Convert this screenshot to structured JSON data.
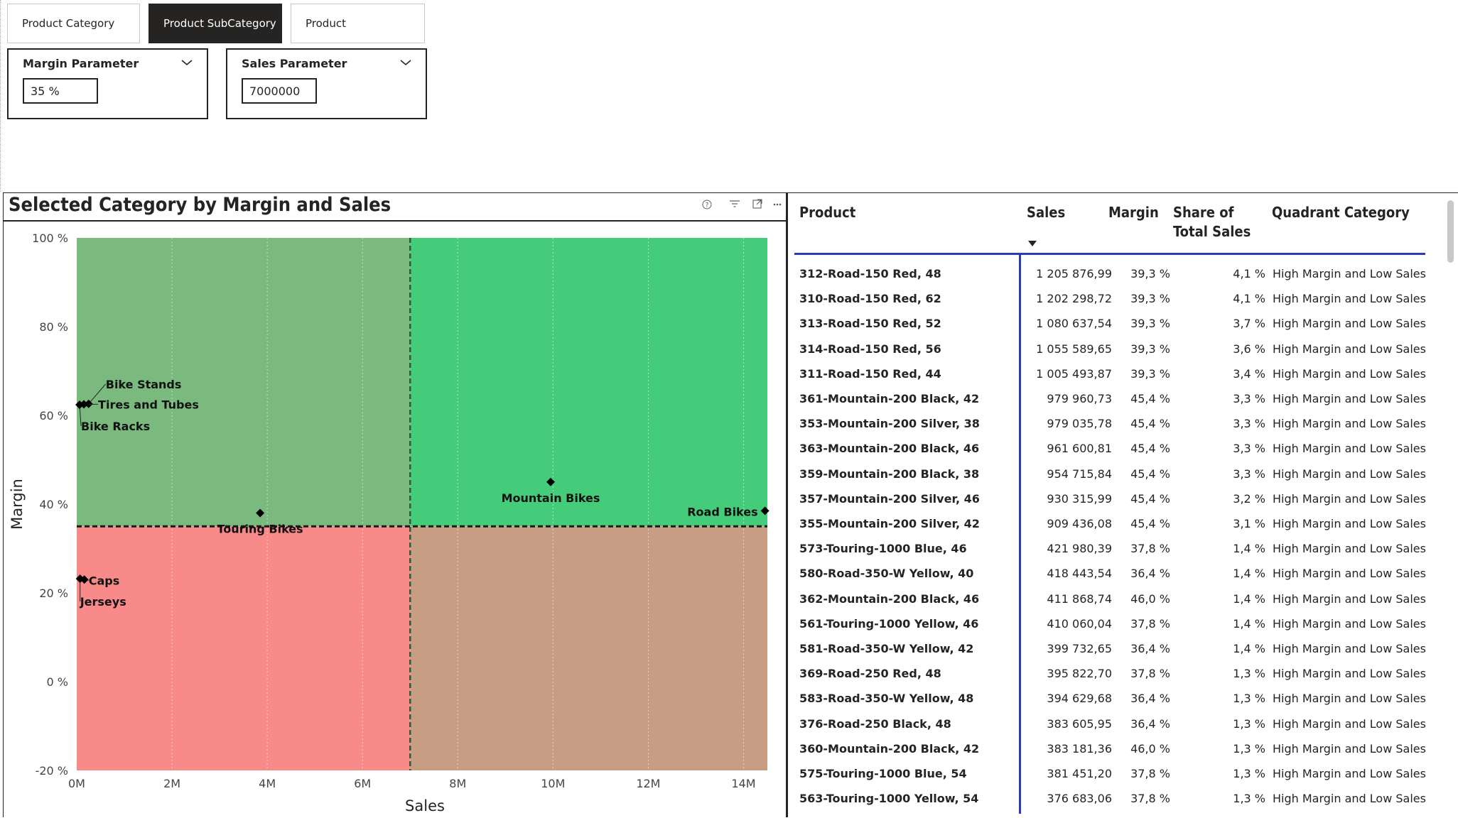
{
  "tabs": [
    {
      "label": "Product Category",
      "active": false
    },
    {
      "label": "Product SubCategory",
      "active": true
    },
    {
      "label": "Product",
      "active": false
    }
  ],
  "slicers": {
    "margin": {
      "title": "Margin Parameter",
      "value": "35 %"
    },
    "sales": {
      "title": "Sales Parameter",
      "value": "7000000"
    }
  },
  "visual_icons": [
    "help-icon",
    "filter-icon",
    "focus-mode-icon",
    "more-options-icon"
  ],
  "colors": {
    "q_high_margin_low_sales": "#7aba7e",
    "q_high_margin_high_sales": "#45cc7a",
    "q_low_margin_low_sales": "#f88a8a",
    "q_low_margin_high_sales": "#c79e84",
    "header_accent": "#2b3bb2"
  },
  "chart_data": {
    "type": "scatter",
    "title": "Selected Category by Margin and Sales",
    "xlabel": "Sales",
    "ylabel": "Margin",
    "xlim": [
      0,
      14500000
    ],
    "ylim": [
      -20,
      100
    ],
    "x_ticks": [
      {
        "v": 0,
        "label": "0M"
      },
      {
        "v": 2000000,
        "label": "2M"
      },
      {
        "v": 4000000,
        "label": "4M"
      },
      {
        "v": 6000000,
        "label": "6M"
      },
      {
        "v": 8000000,
        "label": "8M"
      },
      {
        "v": 10000000,
        "label": "10M"
      },
      {
        "v": 12000000,
        "label": "12M"
      },
      {
        "v": 14000000,
        "label": "14M"
      }
    ],
    "y_ticks": [
      {
        "v": 100,
        "label": "100 %"
      },
      {
        "v": 80,
        "label": "80 %"
      },
      {
        "v": 60,
        "label": "60 %"
      },
      {
        "v": 40,
        "label": "40 %"
      },
      {
        "v": 20,
        "label": "20 %"
      },
      {
        "v": 0,
        "label": "0 %"
      },
      {
        "v": -20,
        "label": "-20 %"
      }
    ],
    "thresholds": {
      "sales": 7000000,
      "margin": 35
    },
    "points": [
      {
        "name": "Bike Stands",
        "x": 250000,
        "y": 62.6
      },
      {
        "name": "Tires and Tubes",
        "x": 150000,
        "y": 62.5
      },
      {
        "name": "Bike Racks",
        "x": 60000,
        "y": 62.4
      },
      {
        "name": "Mountain Bikes",
        "x": 9950000,
        "y": 45.0
      },
      {
        "name": "Road Bikes",
        "x": 14450000,
        "y": 38.5
      },
      {
        "name": "Touring Bikes",
        "x": 3850000,
        "y": 38.0
      },
      {
        "name": "Caps",
        "x": 160000,
        "y": 23.0
      },
      {
        "name": "Jerseys",
        "x": 70000,
        "y": 23.2
      }
    ]
  },
  "table": {
    "headers": {
      "product": "Product",
      "sales": "Sales",
      "margin": "Margin",
      "share_line1": "Share of",
      "share_line2": "Total Sales",
      "quadrant": "Quadrant Category"
    },
    "rows": [
      {
        "product": "312-Road-150 Red, 48",
        "sales": "1 205 876,99",
        "margin": "39,3 %",
        "share": "4,1 %",
        "quadrant": "High Margin and Low Sales"
      },
      {
        "product": "310-Road-150 Red, 62",
        "sales": "1 202 298,72",
        "margin": "39,3 %",
        "share": "4,1 %",
        "quadrant": "High Margin and Low Sales"
      },
      {
        "product": "313-Road-150 Red, 52",
        "sales": "1 080 637,54",
        "margin": "39,3 %",
        "share": "3,7 %",
        "quadrant": "High Margin and Low Sales"
      },
      {
        "product": "314-Road-150 Red, 56",
        "sales": "1 055 589,65",
        "margin": "39,3 %",
        "share": "3,6 %",
        "quadrant": "High Margin and Low Sales"
      },
      {
        "product": "311-Road-150 Red, 44",
        "sales": "1 005 493,87",
        "margin": "39,3 %",
        "share": "3,4 %",
        "quadrant": "High Margin and Low Sales"
      },
      {
        "product": "361-Mountain-200 Black, 42",
        "sales": "979 960,73",
        "margin": "45,4 %",
        "share": "3,3 %",
        "quadrant": "High Margin and Low Sales"
      },
      {
        "product": "353-Mountain-200 Silver, 38",
        "sales": "979 035,78",
        "margin": "45,4 %",
        "share": "3,3 %",
        "quadrant": "High Margin and Low Sales"
      },
      {
        "product": "363-Mountain-200 Black, 46",
        "sales": "961 600,81",
        "margin": "45,4 %",
        "share": "3,3 %",
        "quadrant": "High Margin and Low Sales"
      },
      {
        "product": "359-Mountain-200 Black, 38",
        "sales": "954 715,84",
        "margin": "45,4 %",
        "share": "3,3 %",
        "quadrant": "High Margin and Low Sales"
      },
      {
        "product": "357-Mountain-200 Silver, 46",
        "sales": "930 315,99",
        "margin": "45,4 %",
        "share": "3,2 %",
        "quadrant": "High Margin and Low Sales"
      },
      {
        "product": "355-Mountain-200 Silver, 42",
        "sales": "909 436,08",
        "margin": "45,4 %",
        "share": "3,1 %",
        "quadrant": "High Margin and Low Sales"
      },
      {
        "product": "573-Touring-1000 Blue, 46",
        "sales": "421 980,39",
        "margin": "37,8 %",
        "share": "1,4 %",
        "quadrant": "High Margin and Low Sales"
      },
      {
        "product": "580-Road-350-W Yellow, 40",
        "sales": "418 443,54",
        "margin": "36,4 %",
        "share": "1,4 %",
        "quadrant": "High Margin and Low Sales"
      },
      {
        "product": "362-Mountain-200 Black, 46",
        "sales": "411 868,74",
        "margin": "46,0 %",
        "share": "1,4 %",
        "quadrant": "High Margin and Low Sales"
      },
      {
        "product": "561-Touring-1000 Yellow, 46",
        "sales": "410 060,04",
        "margin": "37,8 %",
        "share": "1,4 %",
        "quadrant": "High Margin and Low Sales"
      },
      {
        "product": "581-Road-350-W Yellow, 42",
        "sales": "399 732,65",
        "margin": "36,4 %",
        "share": "1,4 %",
        "quadrant": "High Margin and Low Sales"
      },
      {
        "product": "369-Road-250 Red, 48",
        "sales": "395 822,70",
        "margin": "37,8 %",
        "share": "1,3 %",
        "quadrant": "High Margin and Low Sales"
      },
      {
        "product": "583-Road-350-W Yellow, 48",
        "sales": "394 629,68",
        "margin": "36,4 %",
        "share": "1,3 %",
        "quadrant": "High Margin and Low Sales"
      },
      {
        "product": "376-Road-250 Black, 48",
        "sales": "383 605,95",
        "margin": "36,4 %",
        "share": "1,3 %",
        "quadrant": "High Margin and Low Sales"
      },
      {
        "product": "360-Mountain-200 Black, 42",
        "sales": "383 181,36",
        "margin": "46,0 %",
        "share": "1,3 %",
        "quadrant": "High Margin and Low Sales"
      },
      {
        "product": "575-Touring-1000 Blue, 54",
        "sales": "381 451,20",
        "margin": "37,8 %",
        "share": "1,3 %",
        "quadrant": "High Margin and Low Sales"
      },
      {
        "product": "563-Touring-1000 Yellow, 54",
        "sales": "376 683,06",
        "margin": "37,8 %",
        "share": "1,3 %",
        "quadrant": "High Margin and Low Sales"
      }
    ]
  }
}
